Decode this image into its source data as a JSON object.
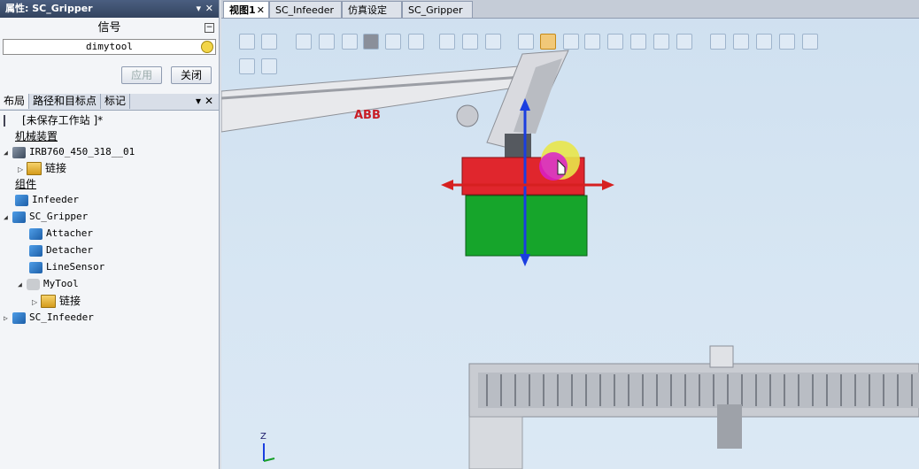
{
  "properties_panel": {
    "title": "属性: SC_Gripper",
    "pin_glyph": "▾",
    "close_glyph": "✕",
    "section_title": "信号",
    "collapse_glyph": "−",
    "value": "dimytool",
    "apply_label": "应用",
    "close_label": "关闭"
  },
  "layout_panel": {
    "tabs": [
      "布局",
      "路径和目标点",
      "标记"
    ],
    "pin_glyph": "▾",
    "close_glyph": "✕",
    "tree": {
      "station": "[未保存工作站 ]*",
      "mechanisms_header": "机械装置",
      "robot": "IRB760_450_318__01",
      "robot_links": "链接",
      "components_header": "组件",
      "infeeder": "Infeeder",
      "gripper": "SC_Gripper",
      "attacher": "Attacher",
      "detacher": "Detacher",
      "linesensor": "LineSensor",
      "mytool": "MyTool",
      "mytool_links": "链接",
      "sc_infeeder": "SC_Infeeder"
    }
  },
  "view": {
    "tabs": [
      "视图1",
      "SC_Infeeder",
      "仿真设定",
      "SC_Gripper"
    ],
    "tab_close_glyph": "✕",
    "robot_brand": "ABB",
    "axis_z_label": "Z"
  },
  "colors": {
    "panel_title_bg": "#3d5070",
    "viewport_bg": "#d3e3f2",
    "gripper_red": "#e0262d",
    "box_green": "#16a52b",
    "gizmo_blue": "#1a3ee0",
    "gizmo_red": "#d62020"
  }
}
